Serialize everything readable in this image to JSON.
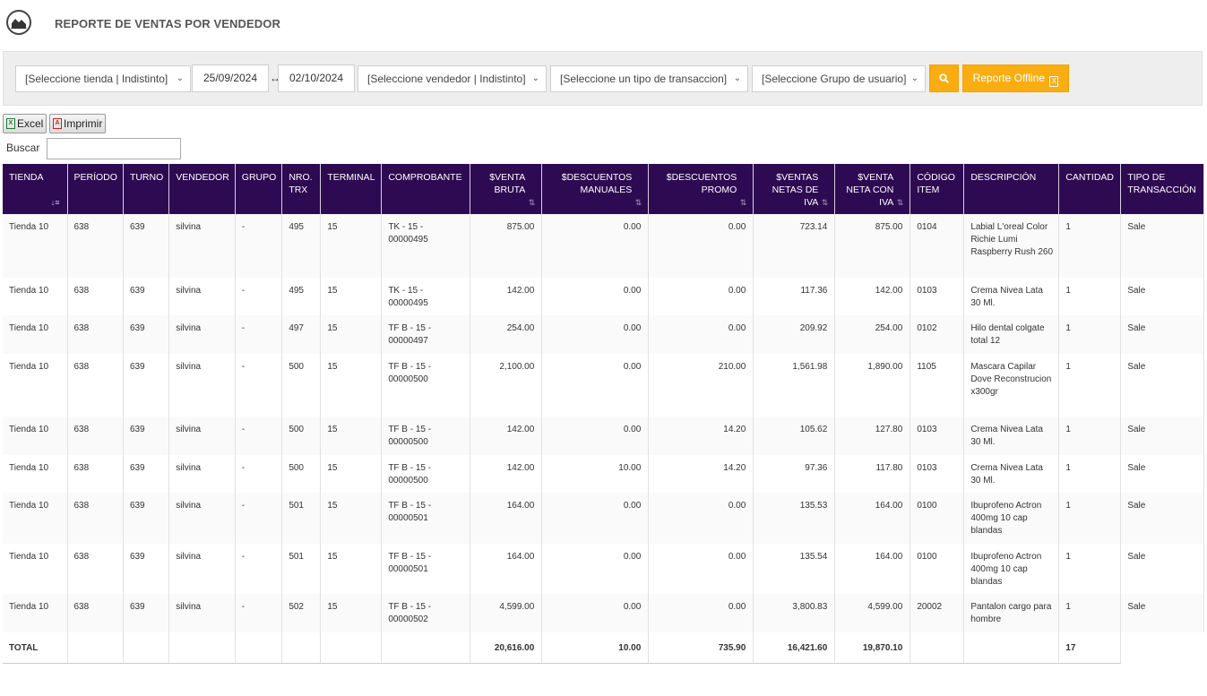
{
  "header": {
    "title": "REPORTE DE VENTAS POR VENDEDOR",
    "logo_icon": "chart-area-icon"
  },
  "filters": {
    "store": "[Seleccione tienda | Indistinto]",
    "date_from": "25/09/2024",
    "date_sep": "↔",
    "date_to": "02/10/2024",
    "seller": "[Seleccione vendedor | Indistinto]",
    "transaction_type": "[Seleccione un tipo de transaccion]",
    "user_group": "[Seleccione Grupo de usuario]",
    "search_icon": "search-icon",
    "offline_label": "Reporte Offline",
    "accent": "#f9ad11"
  },
  "toolbar": {
    "excel_label": "Excel",
    "print_label": "Imprimir",
    "search_label": "Buscar",
    "search_value": ""
  },
  "table": {
    "header_color": "#2e0a52",
    "columns": [
      {
        "key": "tienda",
        "label": "TIENDA",
        "sorted": true
      },
      {
        "key": "periodo",
        "label": "PERÍODO"
      },
      {
        "key": "turno",
        "label": "TURNO"
      },
      {
        "key": "vendedor",
        "label": "VENDEDOR"
      },
      {
        "key": "grupo",
        "label": "GRUPO"
      },
      {
        "key": "nro_trx",
        "label": "NRO. TRX"
      },
      {
        "key": "terminal",
        "label": "TERMINAL"
      },
      {
        "key": "comprobante",
        "label": "COMPROBANTE"
      },
      {
        "key": "venta_bruta",
        "label": "$VENTA BRUTA",
        "sortable": true,
        "num": true
      },
      {
        "key": "desc_manuales",
        "label": "$DESCUENTOS MANUALES",
        "sortable": true,
        "num": true
      },
      {
        "key": "desc_promo",
        "label": "$DESCUENTOS PROMO",
        "sortable": true,
        "num": true
      },
      {
        "key": "netas_sin_iva",
        "label": "$VENTAS NETAS DE IVA",
        "sortable": true,
        "num": true
      },
      {
        "key": "neta_con_iva",
        "label": "$VENTA NETA CON IVA",
        "sortable": true,
        "num": true
      },
      {
        "key": "codigo",
        "label": "CÓDIGO ITEM"
      },
      {
        "key": "descripcion",
        "label": "DESCRIPCIÓN"
      },
      {
        "key": "cantidad",
        "label": "CANTIDAD"
      },
      {
        "key": "tipo",
        "label": "TIPO DE TRANSACCIÓN"
      }
    ],
    "rows": [
      {
        "tienda": "Tienda 10",
        "periodo": "638",
        "turno": "639",
        "vendedor": "silvina",
        "grupo": "-",
        "nro_trx": "495",
        "terminal": "15",
        "comprobante": "TK - 15 - 00000495",
        "venta_bruta": "875.00",
        "desc_manuales": "0.00",
        "desc_promo": "0.00",
        "netas_sin_iva": "723.14",
        "neta_con_iva": "875.00",
        "codigo": "0104",
        "descripcion": "Labial L'oreal Color Richie Lumi Raspberry Rush 260",
        "cantidad": "1",
        "tipo": "Sale"
      },
      {
        "tienda": "Tienda 10",
        "periodo": "638",
        "turno": "639",
        "vendedor": "silvina",
        "grupo": "-",
        "nro_trx": "495",
        "terminal": "15",
        "comprobante": "TK - 15 - 00000495",
        "venta_bruta": "142.00",
        "desc_manuales": "0.00",
        "desc_promo": "0.00",
        "netas_sin_iva": "117.36",
        "neta_con_iva": "142.00",
        "codigo": "0103",
        "descripcion": "Crema Nivea Lata 30 Ml.",
        "cantidad": "1",
        "tipo": "Sale"
      },
      {
        "tienda": "Tienda 10",
        "periodo": "638",
        "turno": "639",
        "vendedor": "silvina",
        "grupo": "-",
        "nro_trx": "497",
        "terminal": "15",
        "comprobante": "TF B - 15 - 00000497",
        "venta_bruta": "254.00",
        "desc_manuales": "0.00",
        "desc_promo": "0.00",
        "netas_sin_iva": "209.92",
        "neta_con_iva": "254.00",
        "codigo": "0102",
        "descripcion": "Hilo dental colgate total 12",
        "cantidad": "1",
        "tipo": "Sale"
      },
      {
        "tienda": "Tienda 10",
        "periodo": "638",
        "turno": "639",
        "vendedor": "silvina",
        "grupo": "-",
        "nro_trx": "500",
        "terminal": "15",
        "comprobante": "TF B - 15 - 00000500",
        "venta_bruta": "2,100.00",
        "desc_manuales": "0.00",
        "desc_promo": "210.00",
        "netas_sin_iva": "1,561.98",
        "neta_con_iva": "1,890.00",
        "codigo": "1105",
        "descripcion": "Mascara Capilar Dove Reconstrucion x300gr",
        "cantidad": "1",
        "tipo": "Sale"
      },
      {
        "tienda": "Tienda 10",
        "periodo": "638",
        "turno": "639",
        "vendedor": "silvina",
        "grupo": "-",
        "nro_trx": "500",
        "terminal": "15",
        "comprobante": "TF B - 15 - 00000500",
        "venta_bruta": "142.00",
        "desc_manuales": "0.00",
        "desc_promo": "14.20",
        "netas_sin_iva": "105.62",
        "neta_con_iva": "127.80",
        "codigo": "0103",
        "descripcion": "Crema Nivea Lata 30 Ml.",
        "cantidad": "1",
        "tipo": "Sale"
      },
      {
        "tienda": "Tienda 10",
        "periodo": "638",
        "turno": "639",
        "vendedor": "silvina",
        "grupo": "-",
        "nro_trx": "500",
        "terminal": "15",
        "comprobante": "TF B - 15 - 00000500",
        "venta_bruta": "142.00",
        "desc_manuales": "10.00",
        "desc_promo": "14.20",
        "netas_sin_iva": "97.36",
        "neta_con_iva": "117.80",
        "codigo": "0103",
        "descripcion": "Crema Nivea Lata 30 Ml.",
        "cantidad": "1",
        "tipo": "Sale"
      },
      {
        "tienda": "Tienda 10",
        "periodo": "638",
        "turno": "639",
        "vendedor": "silvina",
        "grupo": "-",
        "nro_trx": "501",
        "terminal": "15",
        "comprobante": "TF B - 15 - 00000501",
        "venta_bruta": "164.00",
        "desc_manuales": "0.00",
        "desc_promo": "0.00",
        "netas_sin_iva": "135.53",
        "neta_con_iva": "164.00",
        "codigo": "0100",
        "descripcion": "Ibuprofeno Actron 400mg 10 cap blandas",
        "cantidad": "1",
        "tipo": "Sale"
      },
      {
        "tienda": "Tienda 10",
        "periodo": "638",
        "turno": "639",
        "vendedor": "silvina",
        "grupo": "-",
        "nro_trx": "501",
        "terminal": "15",
        "comprobante": "TF B - 15 - 00000501",
        "venta_bruta": "164.00",
        "desc_manuales": "0.00",
        "desc_promo": "0.00",
        "netas_sin_iva": "135.54",
        "neta_con_iva": "164.00",
        "codigo": "0100",
        "descripcion": "Ibuprofeno Actron 400mg 10 cap blandas",
        "cantidad": "1",
        "tipo": "Sale"
      },
      {
        "tienda": "Tienda 10",
        "periodo": "638",
        "turno": "639",
        "vendedor": "silvina",
        "grupo": "-",
        "nro_trx": "502",
        "terminal": "15",
        "comprobante": "TF B - 15 - 00000502",
        "venta_bruta": "4,599.00",
        "desc_manuales": "0.00",
        "desc_promo": "0.00",
        "netas_sin_iva": "3,800.83",
        "neta_con_iva": "4,599.00",
        "codigo": "20002",
        "descripcion": "Pantalon cargo para hombre",
        "cantidad": "1",
        "tipo": "Sale"
      }
    ],
    "totals": {
      "label": "TOTAL",
      "venta_bruta": "20,616.00",
      "desc_manuales": "10.00",
      "desc_promo": "735.90",
      "netas_sin_iva": "16,421.60",
      "neta_con_iva": "19,870.10",
      "cantidad": "17"
    }
  }
}
